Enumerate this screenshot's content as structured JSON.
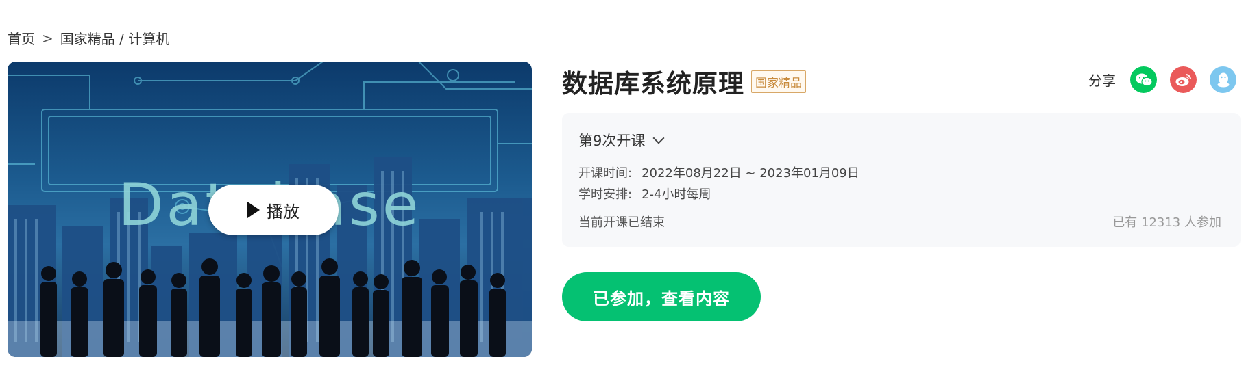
{
  "breadcrumb": {
    "home": "首页",
    "sep": ">",
    "category": "国家精品 / 计算机"
  },
  "cover": {
    "word": "Database",
    "play_label": "播放"
  },
  "course": {
    "title": "数据库系统原理",
    "badge": "国家精品"
  },
  "share": {
    "label": "分享",
    "icons": [
      "wechat-icon",
      "weibo-icon",
      "qq-icon"
    ]
  },
  "session": {
    "term_label": "第9次开课",
    "time_key": "开课时间:",
    "time_value": "2022年08月22日 ~ 2023年01月09日",
    "hours_key": "学时安排:",
    "hours_value": "2-4小时每周",
    "status": "当前开课已结束",
    "participants": "已有 12313 人参加"
  },
  "action": {
    "join_label": "已参加，查看内容"
  },
  "colors": {
    "accent": "#05c172",
    "badge": "#c88b3d",
    "wechat": "#04c95e",
    "weibo": "#ea5a5a",
    "qq": "#7dc7ef"
  }
}
